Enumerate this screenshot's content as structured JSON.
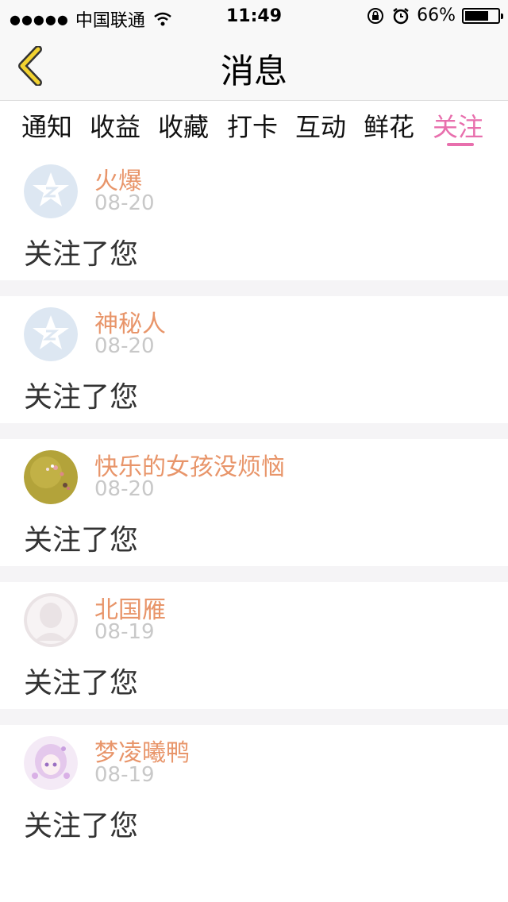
{
  "status_bar": {
    "signal_dots": "●●●●●",
    "carrier": "中国联通",
    "time": "11:49",
    "battery_percent": "66%",
    "battery_level": 0.66
  },
  "header": {
    "title": "消息",
    "back_icon": "chevron-left-icon",
    "accent_color": "#f2d230"
  },
  "tabs": [
    {
      "label": "通知"
    },
    {
      "label": "收益"
    },
    {
      "label": "收藏"
    },
    {
      "label": "打卡"
    },
    {
      "label": "互动"
    },
    {
      "label": "鲜花"
    },
    {
      "label": "关注",
      "active": true
    }
  ],
  "active_tab_color": "#e86fad",
  "messages": [
    {
      "name": "火爆",
      "date": "08-20",
      "text": "关注了您",
      "avatar": "qq-default-avatar"
    },
    {
      "name": "神秘人",
      "date": "08-20",
      "text": "关注了您",
      "avatar": "qq-default-avatar"
    },
    {
      "name": "快乐的女孩没烦恼",
      "date": "08-20",
      "text": "关注了您",
      "avatar": "meadow-photo-avatar"
    },
    {
      "name": "北国雁",
      "date": "08-19",
      "text": "关注了您",
      "avatar": "silhouette-avatar"
    },
    {
      "name": "梦凌曦鸭",
      "date": "08-19",
      "text": "关注了您",
      "avatar": "anime-girl-avatar"
    }
  ],
  "colors": {
    "name": "#e8956a",
    "date": "#c8c8c8",
    "separator": "#f5f4f6"
  }
}
